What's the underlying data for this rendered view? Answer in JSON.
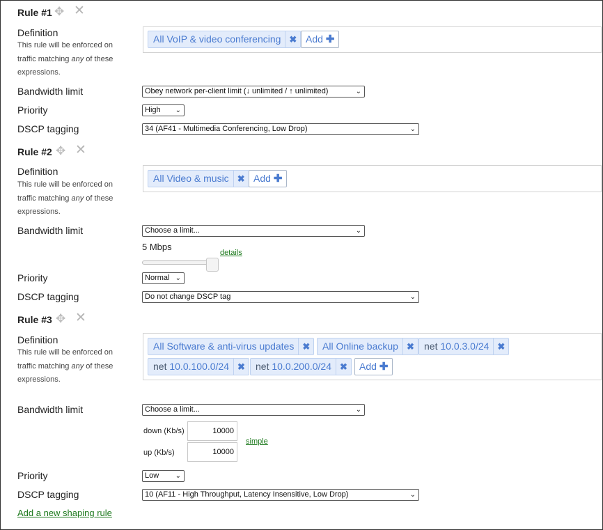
{
  "description_line1": "This rule will be enforced on",
  "description_line2_pre": "traffic matching ",
  "description_line2_em": "any",
  "description_line2_post": " of these",
  "description_line3": "expressions.",
  "labels": {
    "definition": "Definition",
    "bandwidth_limit": "Bandwidth limit",
    "priority": "Priority",
    "dscp_tagging": "DSCP tagging"
  },
  "add_label": "Add",
  "add_icon": "plus-icon",
  "remove_icon": "close-x-icon",
  "move_icon": "move-arrows-icon",
  "delete_icon": "delete-x-icon",
  "tag_color": "#4a7bd0",
  "link_color": "#1e7a1e",
  "rules": [
    {
      "title": "Rule #1",
      "definitions": [
        {
          "prefix": "",
          "text": "All VoIP & video conferencing"
        }
      ],
      "bandwidth_select": "Obey network per-client limit (↓ unlimited / ↑ unlimited)",
      "priority": "High",
      "dscp": "34 (AF41 - Multimedia Conferencing, Low Drop)"
    },
    {
      "title": "Rule #2",
      "definitions": [
        {
          "prefix": "",
          "text": "All Video & music"
        }
      ],
      "bandwidth_select": "Choose a limit...",
      "bandwidth_value": "5 Mbps",
      "slider_fraction": 0.95,
      "details_link": "details",
      "priority": "Normal",
      "dscp": "Do not change DSCP tag"
    },
    {
      "title": "Rule #3",
      "definitions": [
        {
          "prefix": "",
          "text": "All Software & anti-virus updates"
        },
        {
          "prefix": "",
          "text": "All Online backup"
        },
        {
          "prefix": "net",
          "text": "10.0.3.0/24"
        },
        {
          "prefix": "net",
          "text": "10.0.100.0/24"
        },
        {
          "prefix": "net",
          "text": "10.0.200.0/24"
        }
      ],
      "bandwidth_select": "Choose a limit...",
      "down_label": "down (Kb/s)",
      "up_label": "up (Kb/s)",
      "down_value": "10000",
      "up_value": "10000",
      "simple_link": "simple",
      "priority": "Low",
      "dscp": "10 (AF11 - High Throughput, Latency Insensitive, Low Drop)"
    }
  ],
  "add_rule_link": "Add a new shaping rule"
}
